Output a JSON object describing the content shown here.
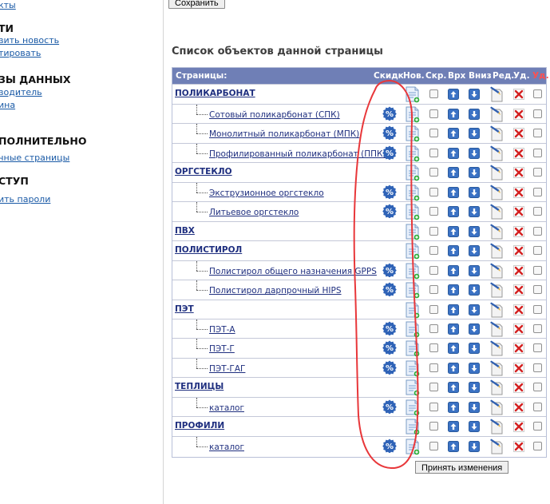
{
  "left_panel": {
    "items": [
      {
        "type": "link",
        "text": "кты"
      },
      {
        "type": "heading",
        "text": "ТИ"
      },
      {
        "type": "link",
        "text": "вить новость"
      },
      {
        "type": "link",
        "text": "тировать"
      },
      {
        "type": "heading",
        "text": "ЗЫ ДАННЫХ"
      },
      {
        "type": "link",
        "text": "водитель"
      },
      {
        "type": "link",
        "text": "ина"
      },
      {
        "type": "heading",
        "text": "ПОЛНИТЕЛЬНО"
      },
      {
        "type": "link",
        "text": "чные страницы"
      },
      {
        "type": "heading",
        "text": "СТУП"
      },
      {
        "type": "link",
        "text": "ить пароли"
      }
    ]
  },
  "save_button": "Сохранить",
  "section_title": "Список объектов данной страницы",
  "table": {
    "headers": {
      "pages": "Страницы:",
      "discount": "Скидк",
      "new": "Нов.",
      "hide": "Скр.",
      "up": "Врх",
      "down": "Вниз",
      "edit": "Ред.",
      "delete": "Уд.",
      "delete_all": "Уд."
    },
    "rows": [
      {
        "kind": "category",
        "label": "ПОЛИКАРБОНАТ"
      },
      {
        "kind": "item",
        "label": "Сотовый поликарбонат (СПК)",
        "discount": true
      },
      {
        "kind": "item",
        "label": "Монолитный поликарбонат (МПК)",
        "discount": true
      },
      {
        "kind": "item",
        "label": "Профилированный поликарбонат (ППК)",
        "discount": true
      },
      {
        "kind": "category",
        "label": "ОРГСТЕКЛО"
      },
      {
        "kind": "item",
        "label": "Экструзионное оргстекло",
        "discount": true
      },
      {
        "kind": "item",
        "label": "Литьевое оргстекло",
        "discount": true
      },
      {
        "kind": "category",
        "label": "ПВХ"
      },
      {
        "kind": "category",
        "label": "ПОЛИСТИРОЛ"
      },
      {
        "kind": "item",
        "label": "Полистирол общего назначения GPPS",
        "discount": true
      },
      {
        "kind": "item",
        "label": "Полистирол дарпрочный HIPS",
        "discount": true
      },
      {
        "kind": "category",
        "label": "ПЭТ"
      },
      {
        "kind": "item",
        "label": "ПЭТ-А",
        "discount": true
      },
      {
        "kind": "item",
        "label": "ПЭТ-Г",
        "discount": true
      },
      {
        "kind": "item",
        "label": "ПЭТ-ГАГ",
        "discount": true
      },
      {
        "kind": "category",
        "label": "ТЕПЛИЦЫ"
      },
      {
        "kind": "item",
        "label": "каталог",
        "discount": true
      },
      {
        "kind": "category",
        "label": "ПРОФИЛИ"
      },
      {
        "kind": "item",
        "label": "каталог",
        "discount": true
      }
    ]
  },
  "apply_button": "Принять изменения",
  "colors": {
    "header_bg": "#6f7fb6",
    "link": "#1f2f7f",
    "discount_badge": "#2f63b7",
    "arrow_btn": "#3b72c4",
    "delete_x": "#d42020",
    "annotation": "#e8373a"
  },
  "icons": {
    "discount": "percent-badge-icon",
    "new": "new-document-icon",
    "up": "arrow-up-icon",
    "down": "arrow-down-icon",
    "edit": "edit-document-icon",
    "delete": "delete-x-icon"
  }
}
